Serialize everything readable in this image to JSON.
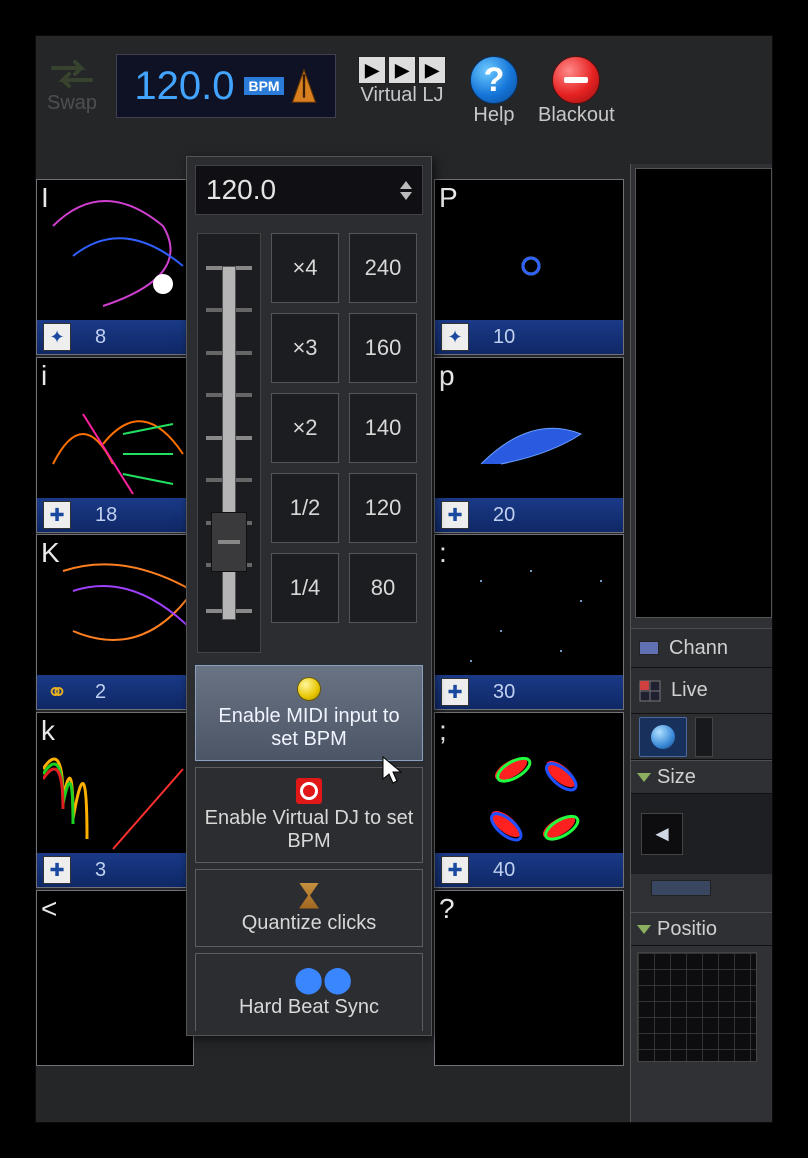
{
  "toolbar": {
    "swap": "Swap",
    "bpm_value": "120.0",
    "bpm_tag": "BPM",
    "virtual_lj": "Virtual LJ",
    "help": "Help",
    "blackout": "Blackout"
  },
  "grid": {
    "left": [
      {
        "label": "I",
        "val": "8"
      },
      {
        "label": "i",
        "val": "18"
      },
      {
        "label": "K",
        "val": "2"
      },
      {
        "label": "k",
        "val": "3"
      },
      {
        "label": "<",
        "val": ""
      }
    ],
    "right": [
      {
        "label": "P",
        "val": "10"
      },
      {
        "label": "p",
        "val": "20"
      },
      {
        "label": ":",
        "val": "30"
      },
      {
        "label": ";",
        "val": "40"
      },
      {
        "label": "?",
        "val": ""
      }
    ]
  },
  "popup": {
    "bpm_numeric": "120.0",
    "mult": [
      "×4",
      "×3",
      "×2",
      "1/2",
      "1/4"
    ],
    "preset": [
      "240",
      "160",
      "140",
      "120",
      "80"
    ],
    "items": [
      {
        "label": "Enable MIDI input to set BPM",
        "selected": true
      },
      {
        "label": "Enable Virtual DJ to set BPM",
        "selected": false
      },
      {
        "label": "Quantize clicks",
        "selected": false
      },
      {
        "label": "Hard Beat Sync",
        "selected": false
      }
    ]
  },
  "right": {
    "channels_header": "Chann",
    "live_label": "Live",
    "size_label": "Size",
    "position_label": "Positio"
  }
}
